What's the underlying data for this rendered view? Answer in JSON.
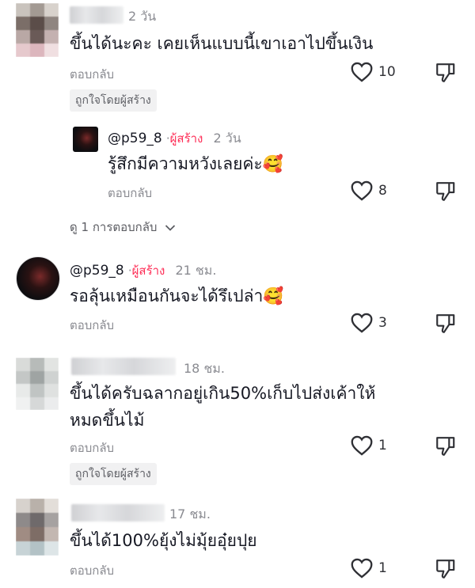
{
  "comments": [
    {
      "time": "2 วัน",
      "text": "ขึ้นได้นะคะ เคยเห็นแบบนี้เขาเอาไปขึ้นเงิน",
      "reply_label": "ตอบกลับ",
      "likes": "10",
      "liked_by_creator": "ถูกใจโดยผู้สร้าง"
    },
    {
      "handle": "@p59_8",
      "creator_label": "ผู้สร้าง",
      "separator": "·",
      "time": "2 วัน",
      "text": "รู้สึกมีความหวังเลยค่ะ🥰",
      "reply_label": "ตอบกลับ",
      "likes": "8"
    },
    {
      "handle": "@p59_8",
      "creator_label": "ผู้สร้าง",
      "separator": "·",
      "time": "21 ชม.",
      "text": "รอลุ้นเหมือนกันจะได้รึเปล่า🥰",
      "reply_label": "ตอบกลับ",
      "likes": "3"
    },
    {
      "time": "18 ชม.",
      "text_line1": "ขึ้นได้ครับฉลากอยู่เกิน50%เก็บไปส่งเค้าให้",
      "text_line2": "หมดขึ้นไม้",
      "reply_label": "ตอบกลับ",
      "likes": "1",
      "liked_by_creator": "ถูกใจโดยผู้สร้าง"
    },
    {
      "time": "17 ชม.",
      "text": "ขึ้นได้100%ยุ้งไม่มุ้ยอุ๋ยปุย",
      "reply_label": "ตอบกลับ",
      "likes": "1"
    }
  ],
  "view_replies": "ดู 1 การตอบกลับ",
  "icons": {
    "like": "heart-outline-icon",
    "dislike": "thumbs-down-icon",
    "expand": "chevron-down-icon"
  },
  "colors": {
    "creator": "#fe2c55",
    "text": "#161823",
    "muted": "#8a8b91",
    "tag_bg": "#f1f1f2"
  }
}
